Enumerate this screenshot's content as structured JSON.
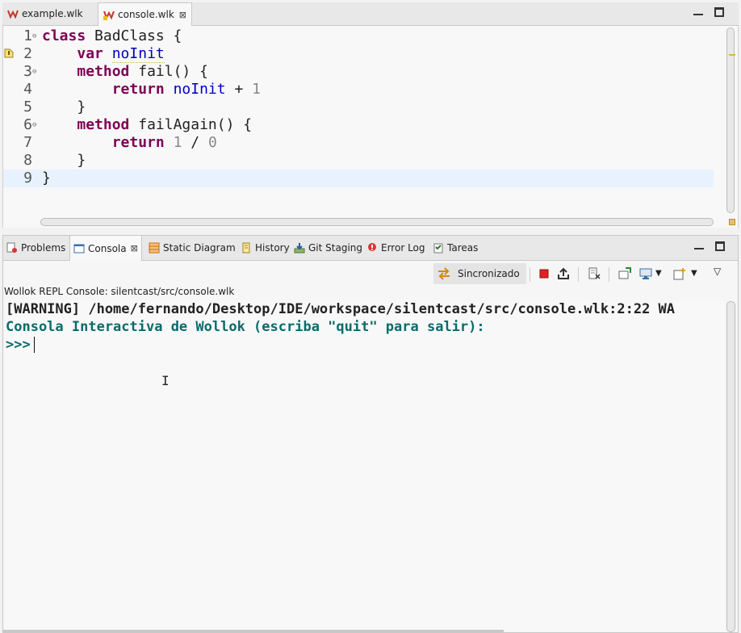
{
  "editor_tabs": [
    {
      "label": "example.wlk",
      "icon": "wollok-icon",
      "active": false
    },
    {
      "label": "console.wlk",
      "icon": "wollok-warning-icon",
      "active": true
    }
  ],
  "close_glyph": "⊠",
  "code_lines": [
    {
      "num": "1",
      "fold": true,
      "tokens": [
        {
          "t": "class",
          "c": "kw"
        },
        {
          "t": " BadClass {",
          "c": ""
        }
      ]
    },
    {
      "num": "2",
      "fold": false,
      "warn": true,
      "tokens": [
        {
          "t": "    ",
          "c": ""
        },
        {
          "t": "var",
          "c": "kw"
        },
        {
          "t": " ",
          "c": ""
        },
        {
          "t": "noInit",
          "c": "var"
        }
      ]
    },
    {
      "num": "3",
      "fold": true,
      "tokens": [
        {
          "t": "    ",
          "c": ""
        },
        {
          "t": "method",
          "c": "kw"
        },
        {
          "t": " fail() {",
          "c": ""
        }
      ]
    },
    {
      "num": "4",
      "fold": false,
      "tokens": [
        {
          "t": "        ",
          "c": ""
        },
        {
          "t": "return",
          "c": "kw"
        },
        {
          "t": " ",
          "c": ""
        },
        {
          "t": "noInit",
          "c": "var"
        },
        {
          "t": " + ",
          "c": ""
        },
        {
          "t": "1",
          "c": "num"
        }
      ]
    },
    {
      "num": "5",
      "fold": false,
      "tokens": [
        {
          "t": "    }",
          "c": ""
        }
      ]
    },
    {
      "num": "6",
      "fold": true,
      "tokens": [
        {
          "t": "    ",
          "c": ""
        },
        {
          "t": "method",
          "c": "kw"
        },
        {
          "t": " failAgain() {",
          "c": ""
        }
      ]
    },
    {
      "num": "7",
      "fold": false,
      "tokens": [
        {
          "t": "        ",
          "c": ""
        },
        {
          "t": "return",
          "c": "kw"
        },
        {
          "t": " ",
          "c": ""
        },
        {
          "t": "1",
          "c": "num"
        },
        {
          "t": " / ",
          "c": ""
        },
        {
          "t": "0",
          "c": "num"
        }
      ]
    },
    {
      "num": "8",
      "fold": false,
      "tokens": [
        {
          "t": "    }",
          "c": ""
        }
      ]
    },
    {
      "num": "9",
      "fold": false,
      "current": true,
      "tokens": [
        {
          "t": "}",
          "c": ""
        }
      ]
    }
  ],
  "panel_tabs": [
    {
      "label": "Problems",
      "icon": "problems-icon"
    },
    {
      "label": "Consola",
      "icon": "console-icon",
      "active": true
    },
    {
      "label": "Static Diagram",
      "icon": "diagram-icon"
    },
    {
      "label": "History",
      "icon": "history-icon"
    },
    {
      "label": "Git Staging",
      "icon": "git-staging-icon"
    },
    {
      "label": "Error Log",
      "icon": "error-log-icon"
    },
    {
      "label": "Tareas",
      "icon": "tasks-icon"
    }
  ],
  "toolbar": {
    "sync_label": "Sincronizado"
  },
  "console_description": "Wollok REPL Console: silentcast/src/console.wlk",
  "console_lines": {
    "warning": "[WARNING] /home/fernando/Desktop/IDE/workspace/silentcast/src/console.wlk:2:22 WA",
    "banner": "Consola Interactiva de Wollok (escriba \"quit\" para salir):",
    "prompt": ">>>"
  },
  "colors": {
    "keyword": "#7f0055",
    "variable": "#0000c0",
    "console_teal": "#0a6b6b"
  }
}
